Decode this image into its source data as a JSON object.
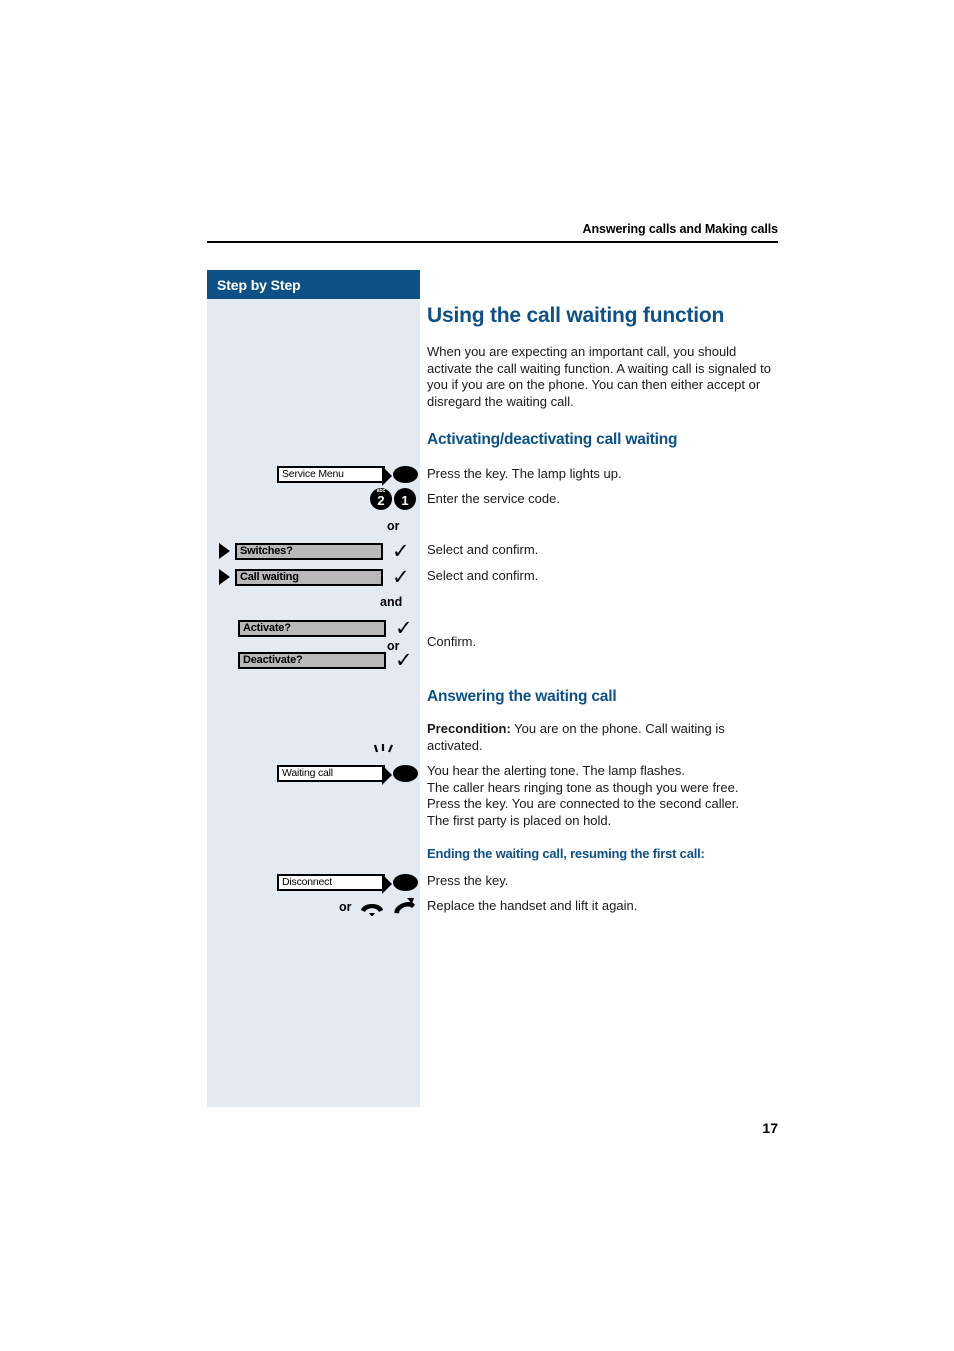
{
  "page": {
    "running_header": "Answering calls and Making calls",
    "number": "17",
    "accent_color": "#0d5186",
    "sidebar_bg": "#e3eaf2"
  },
  "sidebar": {
    "title": "Step by Step",
    "rows": [
      {
        "id": "service-menu",
        "type": "softkey",
        "label": "Service Menu",
        "has_lamp": true,
        "lamp_state": "lit"
      },
      {
        "id": "service-code",
        "type": "keypad",
        "keys": [
          {
            "digit": "2",
            "letters": "abc"
          },
          {
            "digit": "1",
            "letters": ""
          }
        ]
      },
      {
        "id": "conj-or-1",
        "type": "conjunction",
        "label": "or"
      },
      {
        "id": "switches",
        "type": "menu-entry",
        "label": "Switches?",
        "has_cursor": true,
        "has_check": true
      },
      {
        "id": "call-waiting",
        "type": "menu-entry",
        "label": "Call waiting",
        "has_cursor": true,
        "has_check": true
      },
      {
        "id": "conj-and",
        "type": "conjunction",
        "label": "and"
      },
      {
        "id": "activate",
        "type": "menu-entry",
        "label": "Activate?",
        "has_cursor": false,
        "has_check": true
      },
      {
        "id": "conj-or-2",
        "type": "conjunction",
        "label": "or"
      },
      {
        "id": "deactivate",
        "type": "menu-entry",
        "label": "Deactivate?",
        "has_cursor": false,
        "has_check": true
      },
      {
        "id": "waiting-call",
        "type": "softkey",
        "label": "Waiting call",
        "has_lamp": true,
        "lamp_state": "flashing"
      },
      {
        "id": "disconnect",
        "type": "softkey",
        "label": "Disconnect",
        "has_lamp": true,
        "lamp_state": "lit"
      },
      {
        "id": "handset-alt",
        "type": "handset",
        "label": "or",
        "icons": [
          "handset-down-icon",
          "handset-up-icon"
        ]
      }
    ]
  },
  "main": {
    "title": "Using the call waiting function",
    "intro": "When you are expecting an important call, you should activate the call waiting function. A waiting call is signaled to you if you are on the phone. You can then either accept or disregard the waiting call.",
    "section1": {
      "heading": "Activating/deactivating call waiting",
      "steps": [
        "Press the key. The lamp lights up.",
        "Enter the service code.",
        "Select and confirm.",
        "Select and confirm.",
        "Confirm."
      ]
    },
    "section2": {
      "heading": "Answering the waiting call",
      "precondition_label": "Precondition:",
      "precondition_text": " You are on the phone. Call waiting is activated.",
      "description_lines": [
        "You hear the alerting tone. The lamp flashes.",
        "The caller hears ringing tone as though you were free.",
        "Press the key. You are connected to the second caller.",
        "The first party is placed on hold."
      ],
      "subheading": "Ending the waiting call, resuming the first call:",
      "steps": [
        "Press the key.",
        "Replace the handset and lift it again."
      ]
    }
  }
}
